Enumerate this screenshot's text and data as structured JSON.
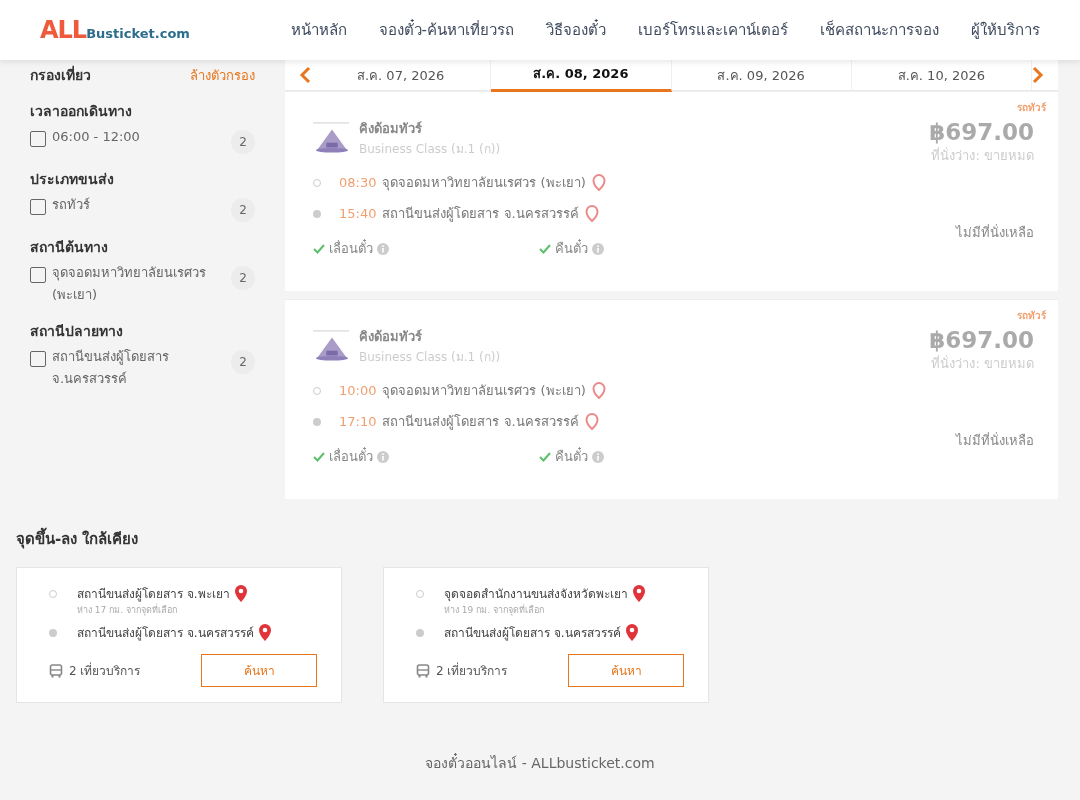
{
  "logo": {
    "main": "ALL",
    "rest": "Busticket.com"
  },
  "nav": [
    "หน้าหลัก",
    "จองตั๋ว-ค้นหาเที่ยวรถ",
    "วิธีจองตั๋ว",
    "เบอร์โทรและเคาน์เตอร์",
    "เช็คสถานะการจอง",
    "ผู้ให้บริการ"
  ],
  "filters": {
    "title": "กรองเที่ยว",
    "clear": "ล้างตัวกรอง",
    "groups": [
      {
        "title": "เวลาออกเดินทาง",
        "options": [
          {
            "label": "06:00 - 12:00",
            "count": "2",
            "checked": false
          }
        ]
      },
      {
        "title": "ประเภทขนส่ง",
        "options": [
          {
            "label": "รถทัวร์",
            "count": "2",
            "checked": false
          }
        ]
      },
      {
        "title": "สถานีต้นทาง",
        "options": [
          {
            "label": "จุดจอดมหาวิทยาลัยนเรศวร (พะเยา)",
            "count": "2",
            "checked": false
          }
        ]
      },
      {
        "title": "สถานีปลายทาง",
        "options": [
          {
            "label": "สถานีขนส่งผู้โดยสาร จ.นครสวรรค์",
            "count": "2",
            "checked": false
          }
        ]
      }
    ]
  },
  "dates": [
    {
      "label": "ส.ค. 07, 2026",
      "selected": false
    },
    {
      "label": "ส.ค. 08, 2026",
      "selected": true
    },
    {
      "label": "ส.ค. 09, 2026",
      "selected": false
    },
    {
      "label": "ส.ค. 10, 2026",
      "selected": false
    }
  ],
  "trips": [
    {
      "badge": "รถทัวร์",
      "operator": "คิงด้อมทัวร์",
      "class": "Business Class (ม.1 (ก))",
      "price": "฿697.00",
      "seats": "ที่นั่งว่าง: ขายหมด",
      "departure": {
        "time": "08:30",
        "place": "จุดจอดมหาวิทยาลัยนเรศวร (พะเยา)"
      },
      "arrival": {
        "time": "15:40",
        "place": "สถานีขนส่งผู้โดยสาร จ.นครสวรรค์"
      },
      "features": [
        "เลื่อนตั๋ว",
        "คืนตั๋ว"
      ],
      "status": "ไม่มีที่นั่งเหลือ"
    },
    {
      "badge": "รถทัวร์",
      "operator": "คิงด้อมทัวร์",
      "class": "Business Class (ม.1 (ก))",
      "price": "฿697.00",
      "seats": "ที่นั่งว่าง: ขายหมด",
      "departure": {
        "time": "10:00",
        "place": "จุดจอดมหาวิทยาลัยนเรศวร (พะเยา)"
      },
      "arrival": {
        "time": "17:10",
        "place": "สถานีขนส่งผู้โดยสาร จ.นครสวรรค์"
      },
      "features": [
        "เลื่อนตั๋ว",
        "คืนตั๋ว"
      ],
      "status": "ไม่มีที่นั่งเหลือ"
    }
  ],
  "nearby": {
    "title": "จุดขึ้น-ลง ใกล้เคียง",
    "cards": [
      {
        "from": "สถานีขนส่งผู้โดยสาร จ.พะเยา",
        "distance": "ห่าง 17 กม. จากจุดที่เลือก",
        "to": "สถานีขนส่งผู้โดยสาร จ.นครสวรรค์",
        "trips": "2 เที่ยวบริการ",
        "button": "ค้นหา"
      },
      {
        "from": "จุดจอดสำนักงานขนส่งจังหวัดพะเยา",
        "distance": "ห่าง 19 กม. จากจุดที่เลือก",
        "to": "สถานีขนส่งผู้โดยสาร จ.นครสวรรค์",
        "trips": "2 เที่ยวบริการ",
        "button": "ค้นหา"
      }
    ]
  },
  "footer": "จองตั๋วออนไลน์ - ALLbusticket.com"
}
